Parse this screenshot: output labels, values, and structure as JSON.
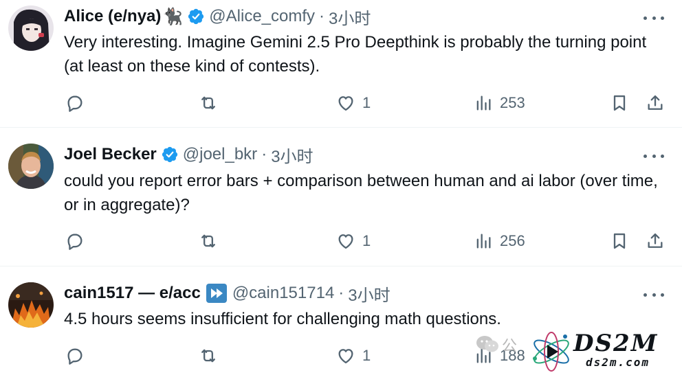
{
  "tweets": [
    {
      "name": "Alice (e/nya)",
      "name_emoji": "🐈‍⬛",
      "handle": "@Alice_comfy",
      "separator": "·",
      "time": "3小时",
      "text": "Very interesting. Imagine Gemini 2.5 Pro Deepthink is probably the turning point (at least on these kind of contests).",
      "like_count": "1",
      "view_count": "253",
      "verified": true
    },
    {
      "name": "Joel Becker",
      "handle": "@joel_bkr",
      "separator": "·",
      "time": "3小时",
      "text": "could you report error bars + comparison between human and ai labor (over time, or in aggregate)?",
      "like_count": "1",
      "view_count": "256",
      "verified": true
    },
    {
      "name": "cain1517 — e/acc",
      "handle": "@cain151714",
      "separator": "·",
      "time": "3小时",
      "text": "4.5 hours seems insufficient for challenging math questions.",
      "like_count": "1",
      "view_count": "188",
      "name_badge": "fast-forward-icon"
    }
  ],
  "watermark": {
    "prefix": "公",
    "title": "DS2M",
    "url": "ds2m.com"
  },
  "colors": {
    "text_primary": "#0f1419",
    "text_secondary": "#536471",
    "verified_blue": "#1d9bf0",
    "divider": "#eff3f4"
  }
}
